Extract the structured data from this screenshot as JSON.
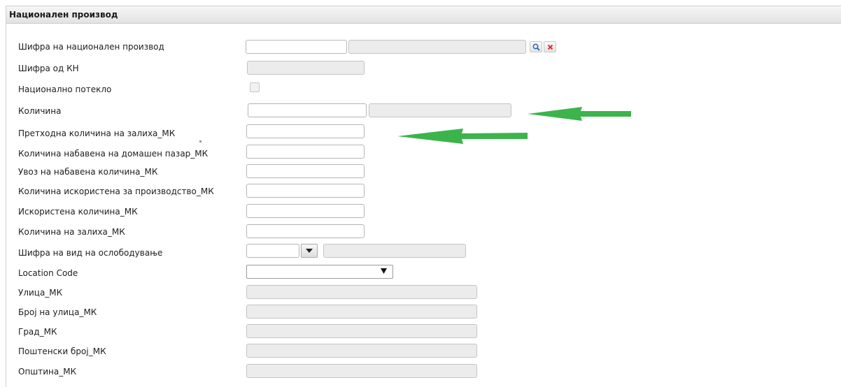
{
  "panel": {
    "title": "Национален производ"
  },
  "fields": {
    "sifra_nacionalen": {
      "label": "Шифра на национален производ",
      "value": "",
      "name_value": ""
    },
    "sifra_kn": {
      "label": "Шифра од КН",
      "value": ""
    },
    "nacionalno_poteklo": {
      "label": "Национално потекло",
      "checked": false
    },
    "kolicina": {
      "label": "Количина",
      "value": "",
      "unit": ""
    },
    "prethodna": {
      "label": "Претходна количина на залиха_МК",
      "value": ""
    },
    "nabavena_domasen": {
      "label": "Количина набавена на домашен пазар_МК",
      "value": ""
    },
    "uvoz": {
      "label": "Увоз на набавена количина_МК",
      "value": ""
    },
    "iskoristena_proizvodstvo": {
      "label": "Количина искористена за производство_МК",
      "value": ""
    },
    "iskoristena": {
      "label": "Искористена количина_МК",
      "value": ""
    },
    "zaliha": {
      "label": "Количина на залиха_МК",
      "value": ""
    },
    "vid_osloboduvanje": {
      "label": "Шифра на вид на ослободување",
      "value": "",
      "description": ""
    },
    "location_code": {
      "label": "Location Code",
      "value": ""
    },
    "ulica": {
      "label": "Улица_МК",
      "value": ""
    },
    "broj_ulica": {
      "label": "Број на улица_МК",
      "value": ""
    },
    "grad": {
      "label": "Град_МК",
      "value": ""
    },
    "postenski_broj": {
      "label": "Поштенски број_МК",
      "value": ""
    },
    "opstina": {
      "label": "Општина_МК",
      "value": ""
    }
  },
  "icons": {
    "search": "magnifier-icon",
    "clear": "red-x-icon",
    "dropdown": "triangle-down-icon"
  },
  "colors": {
    "accent_arrow": "#3cb44b",
    "clear_icon": "#d9342b",
    "search_icon": "#2f6fb5"
  }
}
